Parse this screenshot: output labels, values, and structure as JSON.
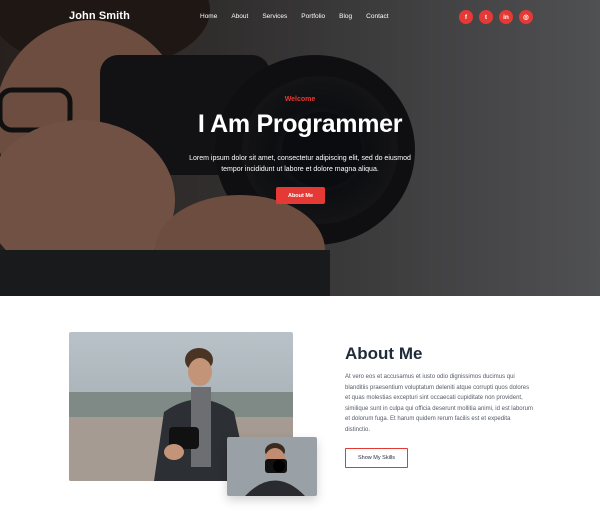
{
  "nav": {
    "brand": "John Smith",
    "items": [
      "Home",
      "About",
      "Services",
      "Portfolio",
      "Blog",
      "Contact"
    ]
  },
  "socials": [
    {
      "icon": "facebook-icon",
      "glyph": "f"
    },
    {
      "icon": "twitter-icon",
      "glyph": "t"
    },
    {
      "icon": "linkedin-icon",
      "glyph": "in"
    },
    {
      "icon": "instagram-icon",
      "glyph": "◎"
    }
  ],
  "hero": {
    "welcome": "Welcome",
    "title": "I Am Programmer",
    "subtitle": "Lorem ipsum dolor sit amet, consectetur adipiscing elit, sed do eiusmod tempor incididunt ut labore et dolore magna aliqua.",
    "button": "About Me"
  },
  "about": {
    "title": "About Me",
    "paragraph": "At vero eos et accusamus et iusto odio dignissimos ducimus qui blanditiis praesentium voluptatum deleniti atque corrupti quos dolores et quas molestias excepturi sint occaecati cupiditate non provident, similique sunt in culpa qui officia deserunt mollitia animi, id est laborum et dolorum fuga. Et harum quidem rerum facilis est et expedita distinctio.",
    "button": "Show My Skills"
  },
  "colors": {
    "accent": "#e53935",
    "heading": "#1f2b3a"
  }
}
